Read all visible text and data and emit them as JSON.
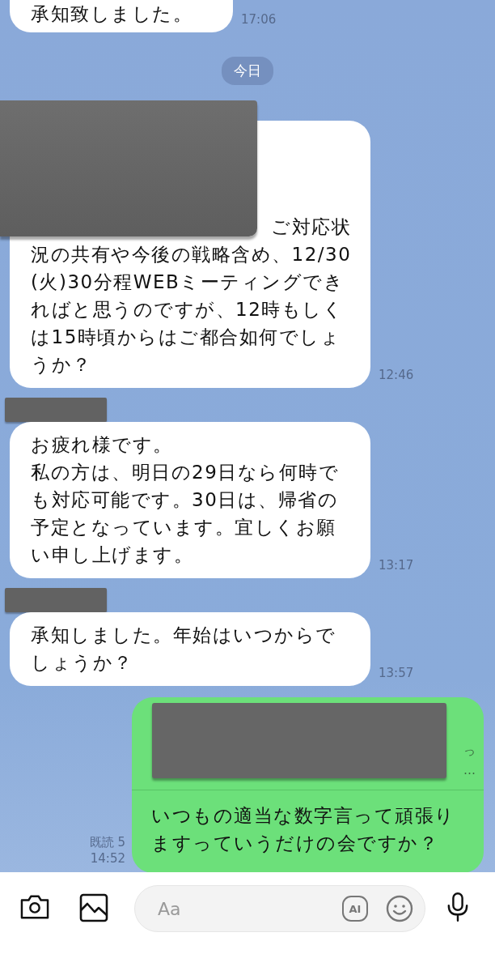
{
  "messages": [
    {
      "kind": "incoming",
      "cut_top": true,
      "text": "承知致しました。",
      "time": "17:06"
    },
    {
      "kind": "date",
      "text": "今日"
    },
    {
      "kind": "incoming",
      "redacted_top": true,
      "lead": "ご対応状",
      "text": "況の共有や今後の戦略含め、12/30(火)30分程WEBミーティングできればと思うのですが、12時もしくは15時頃からはご都合如何でしょうか？",
      "time": "12:46"
    },
    {
      "kind": "incoming",
      "sender_redacted": true,
      "paragraphs": [
        "お疲れ様です。",
        "私の方は、明日の29日なら何時でも対応可能です。30日は、帰省の予定となっています。宜しくお願い申し上げます。"
      ],
      "time": "13:17"
    },
    {
      "kind": "incoming",
      "sender_redacted": true,
      "text": "承知しました。年始はいつからでしょうか？",
      "time": "13:57"
    },
    {
      "kind": "outgoing",
      "quote": [
        "っ",
        "…"
      ],
      "text": "いつもの適当な数字言って頑張りますっていうだけの会ですか？",
      "read": "既読 5",
      "time": "14:52"
    }
  ],
  "composer": {
    "placeholder": "Aa",
    "ai_label": "AI"
  }
}
